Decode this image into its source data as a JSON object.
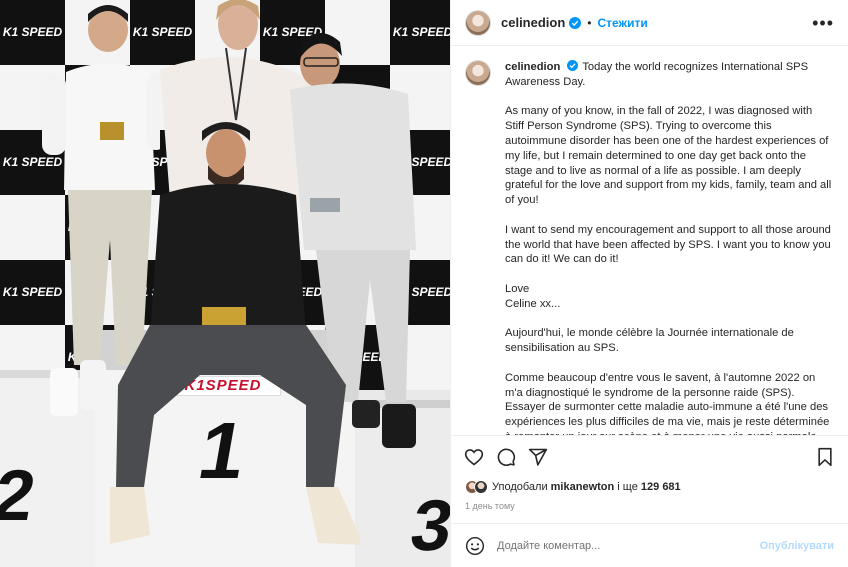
{
  "photo": {
    "banner_logo": "K1SPEED",
    "logo_text": "K1 SPEED",
    "podium_number": "1",
    "side_number_left": "2",
    "side_number_right": "3"
  },
  "header": {
    "username": "celinedion",
    "separator": "•",
    "follow_label": "Стежити",
    "more_icon": "more-horizontal-icon"
  },
  "caption": {
    "username": "celinedion",
    "paragraphs": [
      "Today the world recognizes International SPS Awareness Day.",
      "As many of you know, in the fall of 2022, I was diagnosed with Stiff Person Syndrome (SPS). Trying to overcome this autoimmune disorder has been one of the hardest experiences of my life, but I remain determined to one day get back onto the stage and to live as normal of a life as possible. I am deeply grateful for the love and support from my kids, family, team and all of you!",
      "I want to send my encouragement and support to all those around the world that have been affected by SPS. I want you to know you can do it! We can do it!",
      "Love\nCeline xx...",
      "Aujourd'hui, le monde célèbre la Journée internationale de sensibilisation au SPS.",
      "Comme beaucoup d'entre vous le savent, à l'automne 2022 on m'a diagnostiqué le syndrome de la personne raide (SPS). Essayer de surmonter cette maladie auto-immune a été l'une des expériences les plus difficiles de ma vie, mais je reste déterminée à remonter un jour sur scène et à mener une vie aussi normale que possible. Je suis profondément reconnaissante de l'amour et du soutien"
    ]
  },
  "actions": {
    "like_icon": "heart-icon",
    "comment_icon": "comment-icon",
    "share_icon": "share-icon",
    "save_icon": "bookmark-icon"
  },
  "likes": {
    "prefix": "Уподобали",
    "user": "mikanewton",
    "middle": "і ще",
    "count": "129 681"
  },
  "timestamp": "1 день тому",
  "comment": {
    "placeholder": "Додайте коментар...",
    "post_label": "Опублікувати",
    "emoji_icon": "emoji-icon"
  },
  "colors": {
    "accent": "#0095f6",
    "post_disabled": "#b3dbff",
    "muted": "#8e8e8e"
  }
}
